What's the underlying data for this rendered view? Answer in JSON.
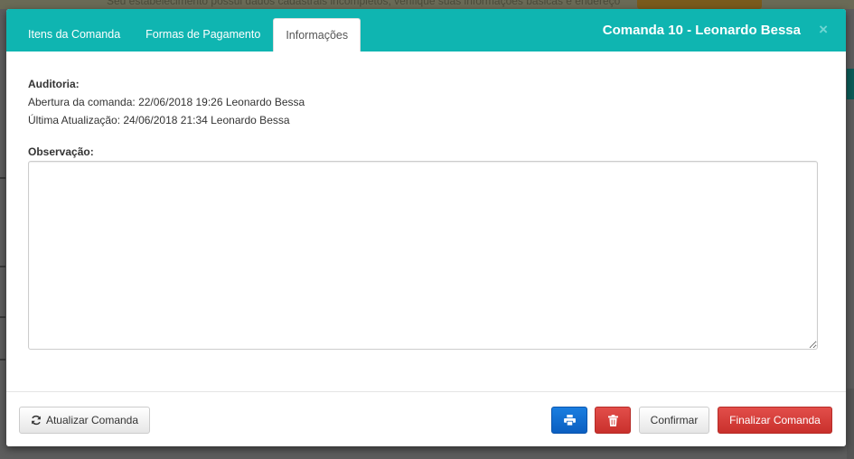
{
  "background": {
    "notice": "Seu estabelecimento possui dados cadastrais incompletos, verifique suas informações básicas e endereço"
  },
  "modal": {
    "tabs": [
      {
        "label": "Itens da Comanda",
        "active": false
      },
      {
        "label": "Formas de Pagamento",
        "active": false
      },
      {
        "label": "Informações",
        "active": true
      }
    ],
    "title": "Comanda 10 - Leonardo Bessa",
    "close_label": "×"
  },
  "info": {
    "audit_heading": "Auditoria:",
    "opened": "Abertura da comanda: 22/06/2018 19:26 Leonardo Bessa",
    "updated": "Última Atualização: 24/06/2018 21:34 Leonardo Bessa",
    "observation_heading": "Observação:",
    "observation_value": ""
  },
  "footer": {
    "refresh_label": "Atualizar Comanda",
    "confirm_label": "Confirmar",
    "finalize_label": "Finalizar Comanda"
  },
  "icons": {
    "refresh": "refresh-icon",
    "print": "print-icon",
    "delete": "trash-icon"
  },
  "colors": {
    "header": "#0fb5b1",
    "primary": "#0b5fc1",
    "danger": "#c9302c"
  }
}
